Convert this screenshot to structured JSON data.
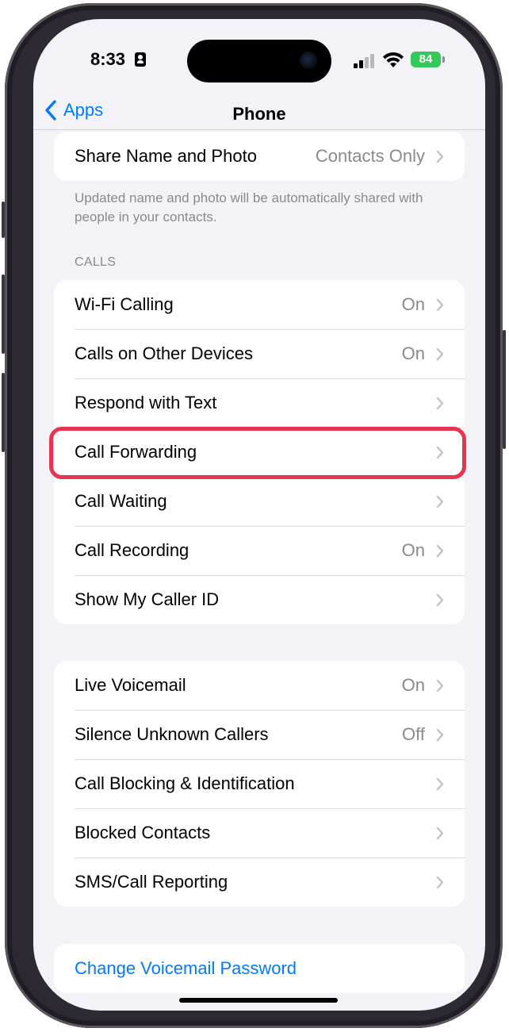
{
  "status_bar": {
    "time": "8:33",
    "battery": "84"
  },
  "nav": {
    "back_label": "Apps",
    "title": "Phone"
  },
  "share_group": {
    "rows": [
      {
        "label": "Share Name and Photo",
        "value": "Contacts Only"
      }
    ],
    "footer": "Updated name and photo will be automatically shared with people in your contacts."
  },
  "calls_section": {
    "header": "CALLS",
    "rows": [
      {
        "label": "Wi-Fi Calling",
        "value": "On"
      },
      {
        "label": "Calls on Other Devices",
        "value": "On"
      },
      {
        "label": "Respond with Text",
        "value": ""
      },
      {
        "label": "Call Forwarding",
        "value": ""
      },
      {
        "label": "Call Waiting",
        "value": ""
      },
      {
        "label": "Call Recording",
        "value": "On"
      },
      {
        "label": "Show My Caller ID",
        "value": ""
      }
    ]
  },
  "voicemail_group": {
    "rows": [
      {
        "label": "Live Voicemail",
        "value": "On"
      },
      {
        "label": "Silence Unknown Callers",
        "value": "Off"
      },
      {
        "label": "Call Blocking & Identification",
        "value": ""
      },
      {
        "label": "Blocked Contacts",
        "value": ""
      },
      {
        "label": "SMS/Call Reporting",
        "value": ""
      }
    ]
  },
  "password_group": {
    "rows": [
      {
        "label": "Change Voicemail Password"
      }
    ]
  },
  "colors": {
    "accent": "#007aff",
    "highlight": "#e8344e",
    "battery": "#34c759",
    "background": "#f2f2f7"
  },
  "highlighted_item": "Call Forwarding"
}
